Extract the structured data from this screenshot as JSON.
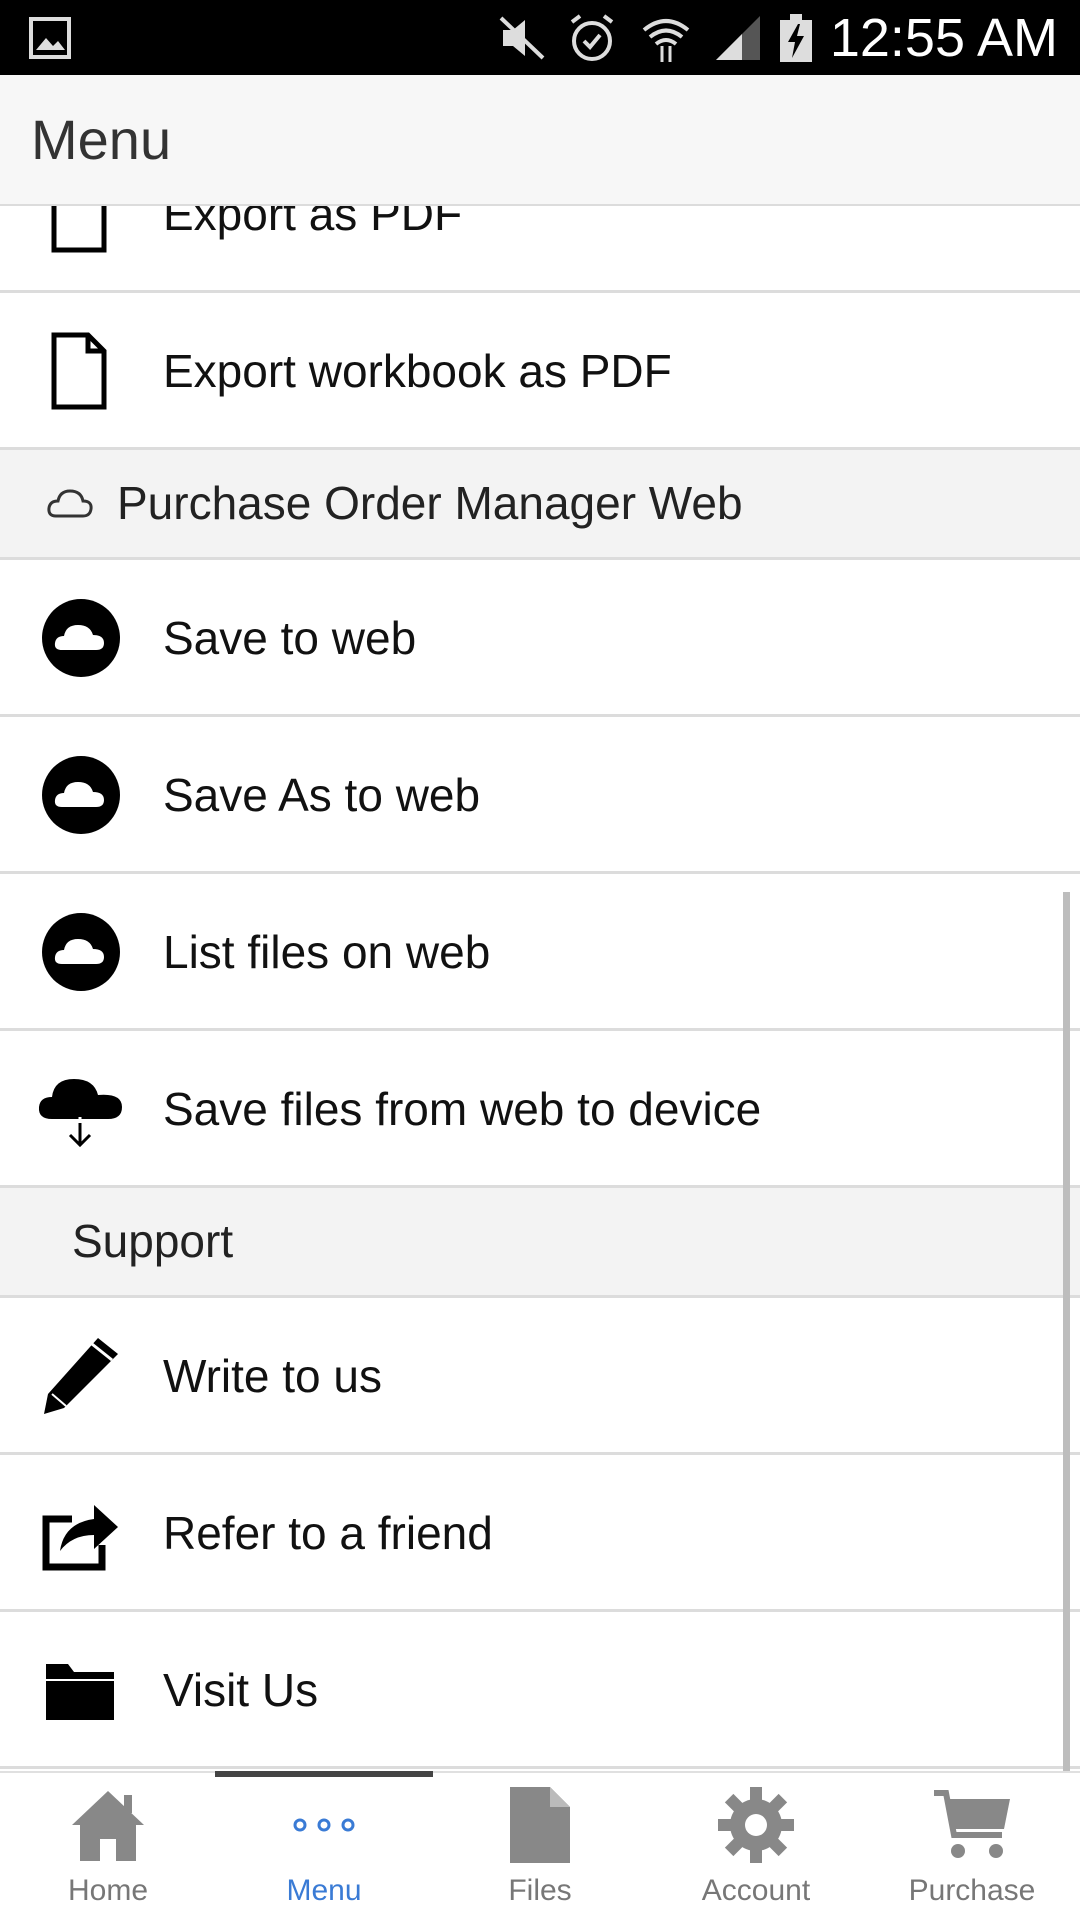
{
  "status_bar": {
    "time": "12:55 AM",
    "icons": [
      "gallery-icon",
      "mute-icon",
      "alarm-icon",
      "wifi-icon",
      "signal-icon",
      "battery-charging-icon"
    ]
  },
  "app_bar": {
    "title": "Menu"
  },
  "menu": {
    "items": [
      {
        "label": "Export as PDF",
        "icon": "document-icon"
      },
      {
        "label": "Export workbook as PDF",
        "icon": "document-icon"
      },
      {
        "section": "Purchase Order Manager Web",
        "icon": "cloud-outline-icon"
      },
      {
        "label": "Save to web",
        "icon": "cloud-circle-icon"
      },
      {
        "label": "Save As to web",
        "icon": "cloud-circle-icon"
      },
      {
        "label": "List files on web",
        "icon": "cloud-circle-icon"
      },
      {
        "label": "Save files from web to device",
        "icon": "cloud-download-icon"
      },
      {
        "section": "Support"
      },
      {
        "label": "Write to us",
        "icon": "pencil-icon"
      },
      {
        "label": "Refer to a friend",
        "icon": "share-icon"
      },
      {
        "label": "Visit Us",
        "icon": "folder-icon"
      }
    ]
  },
  "bottom_nav": {
    "active": "Menu",
    "items": [
      {
        "label": "Home",
        "icon": "home-icon"
      },
      {
        "label": "Menu",
        "icon": "more-horizontal-icon"
      },
      {
        "label": "Files",
        "icon": "file-icon"
      },
      {
        "label": "Account",
        "icon": "gear-icon"
      },
      {
        "label": "Purchase",
        "icon": "cart-icon"
      }
    ]
  },
  "colors": {
    "accent": "#3a7bd5",
    "nav_inactive": "#777777",
    "section_bg": "#f3f3f3",
    "divider": "#dcdcdc"
  }
}
